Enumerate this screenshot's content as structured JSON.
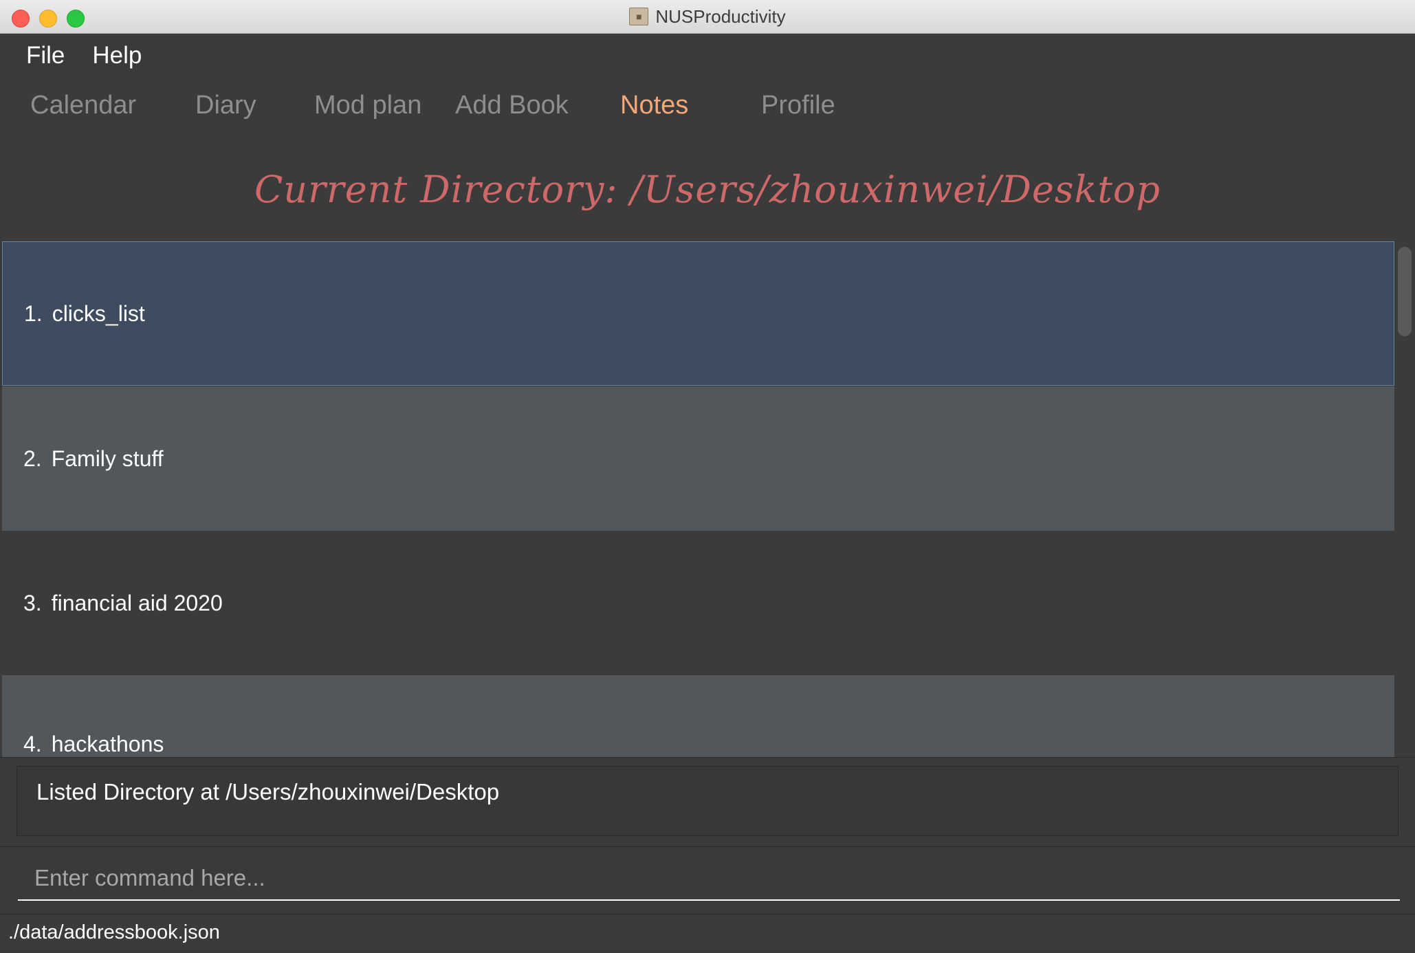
{
  "window": {
    "title": "NUSProductivity"
  },
  "menubar": {
    "items": [
      {
        "label": "File"
      },
      {
        "label": "Help"
      }
    ]
  },
  "tabs": [
    {
      "label": "Calendar",
      "active": false
    },
    {
      "label": "Diary",
      "active": false
    },
    {
      "label": "Mod plan",
      "active": false
    },
    {
      "label": "Add Book",
      "active": false
    },
    {
      "label": "Notes",
      "active": true
    },
    {
      "label": "Profile",
      "active": false
    }
  ],
  "notes": {
    "heading": "Current Directory: /Users/zhouxinwei/Desktop",
    "items": [
      {
        "index": "1.",
        "name": "clicks_list",
        "selected": true
      },
      {
        "index": "2.",
        "name": "Family stuff",
        "selected": false
      },
      {
        "index": "3.",
        "name": "financial aid 2020",
        "selected": false
      },
      {
        "index": "4.",
        "name": "hackathons",
        "selected": false
      }
    ]
  },
  "result": {
    "text": "Listed Directory at /Users/zhouxinwei/Desktop"
  },
  "command": {
    "placeholder": "Enter command here...",
    "value": ""
  },
  "status": {
    "path": "./data/addressbook.json"
  },
  "colors": {
    "active_tab": "#f8a878",
    "heading": "#cf6868",
    "selected_row": "#3f4b5e",
    "alt_row": "#52575b"
  }
}
